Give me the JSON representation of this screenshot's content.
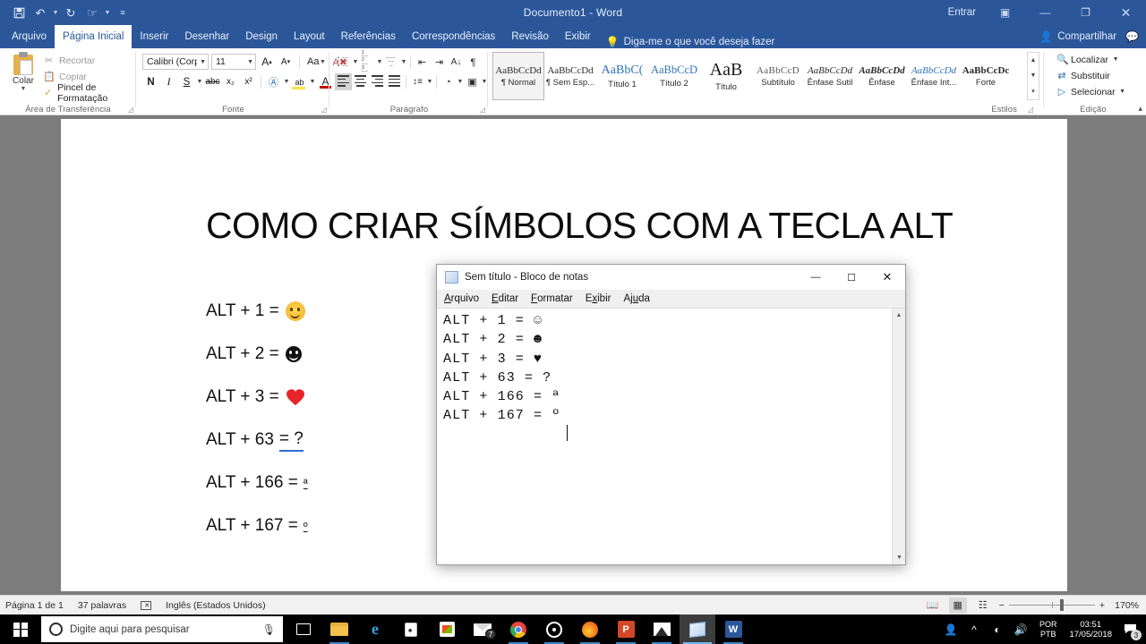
{
  "word": {
    "title": "Documento1  -  Word",
    "quick_access": [
      {
        "name": "save-icon",
        "glyph": "💾"
      },
      {
        "name": "undo-icon",
        "glyph": "↶"
      },
      {
        "name": "redo-icon",
        "glyph": "↻"
      },
      {
        "name": "touch-mode-icon",
        "glyph": "☝"
      },
      {
        "name": "customize-qat-icon",
        "glyph": "☰"
      }
    ],
    "signin_label": "Entrar",
    "window_buttons": {
      "ribbon_display": "▣",
      "minimize": "—",
      "restore": "❐",
      "close": "✕"
    },
    "tabs": [
      {
        "label": "Arquivo",
        "active": false
      },
      {
        "label": "Página Inicial",
        "active": true
      },
      {
        "label": "Inserir",
        "active": false
      },
      {
        "label": "Desenhar",
        "active": false
      },
      {
        "label": "Design",
        "active": false
      },
      {
        "label": "Layout",
        "active": false
      },
      {
        "label": "Referências",
        "active": false
      },
      {
        "label": "Correspondências",
        "active": false
      },
      {
        "label": "Revisão",
        "active": false
      },
      {
        "label": "Exibir",
        "active": false
      }
    ],
    "tellme": "Diga-me o que você deseja fazer",
    "share_label": "Compartilhar",
    "ribbon": {
      "clipboard": {
        "group_label": "Área de Transferência",
        "paste_label": "Colar",
        "cut_label": "Recortar",
        "copy_label": "Copiar",
        "format_painter_label": "Pincel de Formatação"
      },
      "font": {
        "group_label": "Fonte",
        "font_name": "Calibri (Corp",
        "font_size": "11",
        "bold": "N",
        "italic": "I",
        "underline": "S",
        "strikethrough": "abc",
        "subscript": "x₂",
        "superscript": "x²",
        "grow_font": "A",
        "shrink_font": "A",
        "change_case": "Aa",
        "clear_formatting": "A"
      },
      "paragraph": {
        "group_label": "Parágrafo"
      },
      "styles": {
        "group_label": "Estilos",
        "items": [
          {
            "preview": "AaBbCcDd",
            "name": "¶ Normal",
            "selected": true,
            "cls": ""
          },
          {
            "preview": "AaBbCcDd",
            "name": "¶ Sem Esp...",
            "selected": false,
            "cls": ""
          },
          {
            "preview": "AaBbC(",
            "name": "Título 1",
            "selected": false,
            "cls": "sp-h1"
          },
          {
            "preview": "AaBbCcD",
            "name": "Título 2",
            "selected": false,
            "cls": "sp-h2"
          },
          {
            "preview": "AaB",
            "name": "Título",
            "selected": false,
            "cls": "sp-title"
          },
          {
            "preview": "AaBbCcD",
            "name": "Subtítulo",
            "selected": false,
            "cls": "sp-sub"
          },
          {
            "preview": "AaBbCcDd",
            "name": "Ênfase Sutil",
            "selected": false,
            "cls": "sp-it"
          },
          {
            "preview": "AaBbCcDd",
            "name": "Ênfase",
            "selected": false,
            "cls": "sp-it sp-strong"
          },
          {
            "preview": "AaBbCcDd",
            "name": "Ênfase Int...",
            "selected": false,
            "cls": "sp-it sp-eint"
          },
          {
            "preview": "AaBbCcDc",
            "name": "Forte",
            "selected": false,
            "cls": "sp-strong"
          }
        ]
      },
      "editing": {
        "group_label": "Edição",
        "find_label": "Localizar",
        "replace_label": "Substituir",
        "select_label": "Selecionar"
      }
    },
    "document": {
      "title": "COMO CRIAR SÍMBOLOS COM A TECLA ALT",
      "lines": [
        {
          "text": "ALT + 1 =",
          "symbol": "smiley-white",
          "symbol_char": "☺"
        },
        {
          "text": "ALT + 2 =",
          "symbol": "smiley-black",
          "symbol_char": "☻"
        },
        {
          "text": "ALT + 3 =",
          "symbol": "heart-red",
          "symbol_char": "♥"
        },
        {
          "text": "ALT + 63",
          "symbol": "question-grammar",
          "symbol_char": "= ?"
        },
        {
          "text": "ALT + 166 =",
          "symbol": "ordinal-a",
          "symbol_char": "ª"
        },
        {
          "text": "ALT + 167 =",
          "symbol": "ordinal-o",
          "symbol_char": "º"
        }
      ]
    },
    "statusbar": {
      "page": "Página 1 de 1",
      "words": "37 palavras",
      "language": "Inglês (Estados Unidos)",
      "zoom_out": "−",
      "zoom_in": "+",
      "zoom_level": "170%"
    }
  },
  "notepad": {
    "title": "Sem título - Bloco de notas",
    "window_buttons": {
      "minimize": "—",
      "maximize": "☐",
      "close": "✕"
    },
    "menu": [
      {
        "label": "Arquivo",
        "mnemonic": "A"
      },
      {
        "label": "Editar",
        "mnemonic": "E"
      },
      {
        "label": "Formatar",
        "mnemonic": "F"
      },
      {
        "label": "Exibir",
        "mnemonic": "x"
      },
      {
        "label": "Ajuda",
        "mnemonic": "u"
      }
    ],
    "content": "ALT + 1 = ☺\nALT + 2 = ☻\nALT + 3 = ♥\nALT + 63 = ?\nALT + 166 = ª\nALT + 167 = º"
  },
  "taskbar": {
    "search_placeholder": "Digite aqui para pesquisar",
    "apps": [
      {
        "name": "task-view",
        "glyph": "❐",
        "state": "",
        "badge": ""
      },
      {
        "name": "file-explorer",
        "glyph": "📁",
        "state": "running",
        "badge": ""
      },
      {
        "name": "microsoft-edge",
        "glyph": "e",
        "state": "",
        "badge": ""
      },
      {
        "name": "solitaire",
        "glyph": "♣",
        "state": "",
        "badge": ""
      },
      {
        "name": "microsoft-store",
        "glyph": "🛍",
        "state": "",
        "badge": ""
      },
      {
        "name": "mail",
        "glyph": "✉",
        "state": "",
        "badge": "7"
      },
      {
        "name": "google-chrome",
        "glyph": "●",
        "state": "running",
        "badge": ""
      },
      {
        "name": "media-player",
        "glyph": "◎",
        "state": "running",
        "badge": ""
      },
      {
        "name": "mozilla-firefox",
        "glyph": "●",
        "state": "running",
        "badge": ""
      },
      {
        "name": "powerpoint",
        "glyph": "P",
        "state": "running",
        "badge": ""
      },
      {
        "name": "photos",
        "glyph": "⛰",
        "state": "running",
        "badge": ""
      },
      {
        "name": "notepad",
        "glyph": "📄",
        "state": "active",
        "badge": ""
      },
      {
        "name": "word",
        "glyph": "W",
        "state": "running",
        "badge": ""
      }
    ],
    "tray": {
      "people": "☺",
      "show_hidden": "⌃",
      "network": "◴",
      "volume": "🔊",
      "lang_top": "POR",
      "lang_bottom": "PTB",
      "time": "03:51",
      "date": "17/05/2018",
      "notifications": "3"
    }
  }
}
